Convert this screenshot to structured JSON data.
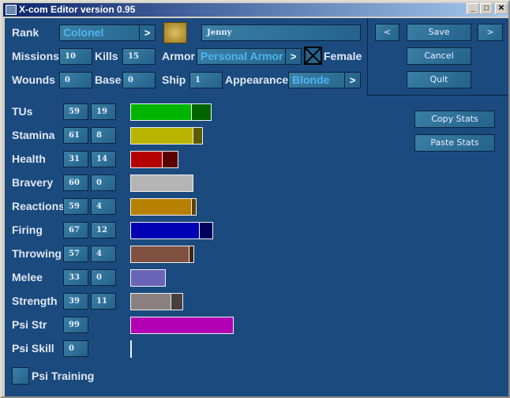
{
  "window": {
    "title": "X-com Editor version 0.95"
  },
  "soldier": {
    "rank_label": "Rank",
    "rank": "Colonel",
    "name": "Jenny",
    "missions_label": "Missions",
    "missions": "10",
    "kills_label": "Kills",
    "kills": "15",
    "armor_label": "Armor",
    "armor": "Personal Armor",
    "female_label": "Female",
    "female_checked": true,
    "wounds_label": "Wounds",
    "wounds": "0",
    "base_label": "Base",
    "base": "0",
    "ship_label": "Ship",
    "ship": "1",
    "appearance_label": "Appearance",
    "appearance": "Blonde"
  },
  "buttons": {
    "prev": "<",
    "save": "Save",
    "next": ">",
    "cancel": "Cancel",
    "quit": "Quit",
    "copy": "Copy Stats",
    "paste": "Paste Stats",
    "arrow": ">"
  },
  "stats": [
    {
      "label": "TUs",
      "base": "59",
      "bonus": "19",
      "color": "#00b400",
      "bonus_color": "#006400"
    },
    {
      "label": "Stamina",
      "base": "61",
      "bonus": "8",
      "color": "#b8b400",
      "bonus_color": "#5c5a00"
    },
    {
      "label": "Health",
      "base": "31",
      "bonus": "14",
      "color": "#b40000",
      "bonus_color": "#5c0000"
    },
    {
      "label": "Bravery",
      "base": "60",
      "bonus": "0",
      "color": "#b4b4b4",
      "bonus_color": "#5a5a5a"
    },
    {
      "label": "Reactions",
      "base": "59",
      "bonus": "4",
      "color": "#b88000",
      "bonus_color": "#5c4000"
    },
    {
      "label": "Firing",
      "base": "67",
      "bonus": "12",
      "color": "#0000b4",
      "bonus_color": "#00005c"
    },
    {
      "label": "Throwing",
      "base": "57",
      "bonus": "4",
      "color": "#805040",
      "bonus_color": "#402818"
    },
    {
      "label": "Melee",
      "base": "33",
      "bonus": "0",
      "color": "#6a64b8",
      "bonus_color": "#34305c"
    },
    {
      "label": "Strength",
      "base": "39",
      "bonus": "11",
      "color": "#8a8080",
      "bonus_color": "#484040"
    },
    {
      "label": "Psi Str",
      "base": "99",
      "color": "#b400b4"
    },
    {
      "label": "Psi Skill",
      "base": "0",
      "color": "#b4b4b4"
    }
  ],
  "psi_training": {
    "label": "Psi Training",
    "checked": false
  }
}
